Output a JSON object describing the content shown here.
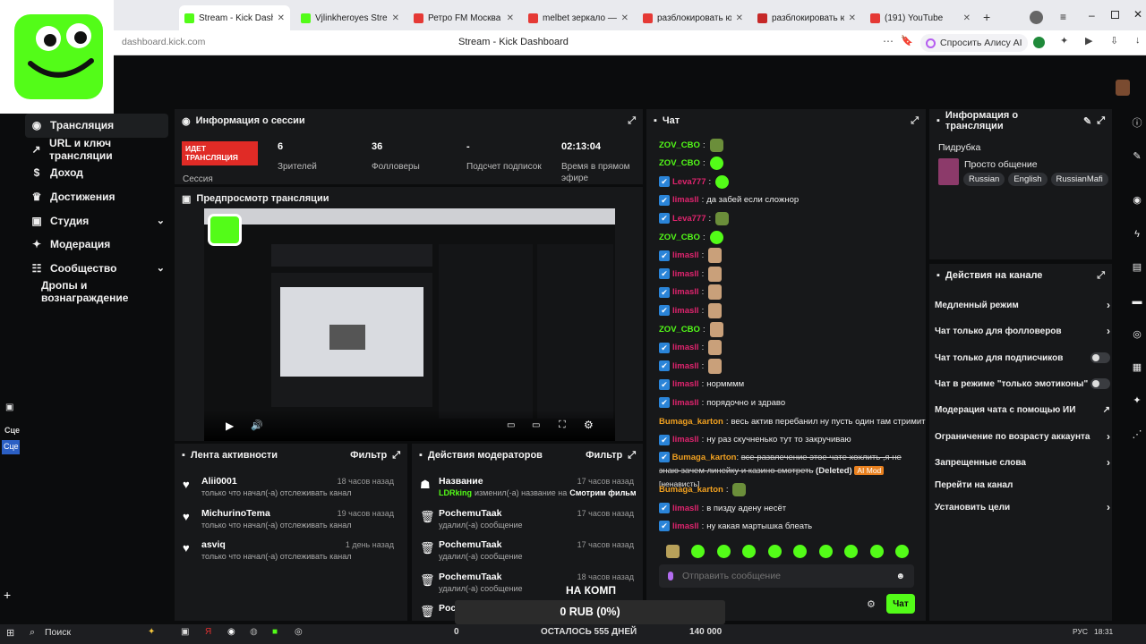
{
  "browser": {
    "tabs": [
      {
        "label": "Stream - Kick Dashbo",
        "active": true,
        "color": "#53fc18"
      },
      {
        "label": "Vjlinkheroyes Stream - W",
        "active": false,
        "color": "#53fc18"
      },
      {
        "label": "Ретро FM Москва",
        "active": false,
        "color": "#e53935"
      },
      {
        "label": "melbet зеркало — Яндe",
        "active": false,
        "color": "#e53935"
      },
      {
        "label": "разблокировать ютуб в",
        "active": false,
        "color": "#e53935"
      },
      {
        "label": "разблокировать ютуб",
        "active": false,
        "color": "#c62828"
      },
      {
        "label": "(191) YouTube",
        "active": false,
        "color": "#e53935"
      }
    ],
    "address": "dashboard.kick.com",
    "page_title": "Stream - Kick Dashboard",
    "alice_label": "Спросить Алису AI"
  },
  "sidebar": {
    "items": [
      {
        "label": "Трансляция",
        "icon": "broadcast-icon",
        "active": true,
        "chev": false
      },
      {
        "label": "URL и ключ трансляции",
        "icon": "link-icon",
        "active": false,
        "chev": false
      },
      {
        "label": "Доход",
        "icon": "dollar-icon",
        "active": false,
        "chev": false
      },
      {
        "label": "Достижения",
        "icon": "trophy-icon",
        "active": false,
        "chev": false
      },
      {
        "label": "Студия",
        "icon": "studio-icon",
        "active": false,
        "chev": true
      },
      {
        "label": "Модерация",
        "icon": "wrench-icon",
        "active": false,
        "chev": false
      },
      {
        "label": "Сообщество",
        "icon": "community-icon",
        "active": false,
        "chev": true
      },
      {
        "label": "Дропы и вознаграждение",
        "icon": "",
        "active": false,
        "chev": false
      }
    ],
    "scene_label": "Сце"
  },
  "session": {
    "title": "Информация о сессии",
    "live_badge": "ИДЕТ ТРАНСЛЯЦИЯ",
    "session_label": "Сессия",
    "stats": [
      {
        "value": "6",
        "label": "Зрителей"
      },
      {
        "value": "36",
        "label": "Фолловеры"
      },
      {
        "value": "-",
        "label": "Подсчет подписок"
      },
      {
        "value": "02:13:04",
        "label": "Время в прямом эфире"
      }
    ]
  },
  "preview": {
    "title": "Предпросмотр трансляции"
  },
  "activity": {
    "title": "Лента активности",
    "filter": "Фильтр",
    "items": [
      {
        "name": "Alii0001",
        "text": "только что начал(-а) отслеживать канал",
        "time": "18 часов назад"
      },
      {
        "name": "MichurinoTema",
        "text": "только что начал(-а) отслеживать канал",
        "time": "19 часов назад"
      },
      {
        "name": "asviq",
        "text": "только что начал(-а) отслеживать канал",
        "time": "1 день назад"
      }
    ]
  },
  "moderators": {
    "title": "Действия модераторов",
    "filter": "Фильтр",
    "items": [
      {
        "name": "Название",
        "user": "LDRking",
        "text": "изменил(-а) название на",
        "extra": "Смотрим фильм",
        "time": "17 часов назад",
        "icon": "person-icon"
      },
      {
        "name": "PochemuTaak",
        "user": "",
        "text": "удалил(-а) сообщение",
        "extra": "",
        "time": "17 часов назад",
        "icon": "trash-icon"
      },
      {
        "name": "PochemuTaak",
        "user": "",
        "text": "удалил(-а) сообщение",
        "extra": "",
        "time": "17 часов назад",
        "icon": "trash-icon"
      },
      {
        "name": "PochemuTaak",
        "user": "",
        "text": "удалил(-а) сообщение",
        "extra": "",
        "time": "18 часов назад",
        "icon": "trash-icon"
      },
      {
        "name": "Poch",
        "user": "",
        "text": "",
        "extra": "",
        "time": "",
        "icon": "trash-icon"
      }
    ],
    "overlay_text": "НА КОМП"
  },
  "chat": {
    "title": "Чат",
    "lines": [
      {
        "user": "ZOV_CBO",
        "color": "#53fc18",
        "badge": false,
        "text": "",
        "emote": "frog"
      },
      {
        "user": "ZOV_CBO",
        "color": "#53fc18",
        "badge": false,
        "text": "",
        "emote": "kick"
      },
      {
        "user": "Leva777",
        "color": "#e0246e",
        "badge": true,
        "text": "",
        "emote": "kick"
      },
      {
        "user": "limasll",
        "color": "#e0246e",
        "badge": true,
        "text": "да забей если сложнор",
        "emote": ""
      },
      {
        "user": "Leva777",
        "color": "#e0246e",
        "badge": true,
        "text": "",
        "emote": "frog"
      },
      {
        "user": "ZOV_CBO",
        "color": "#53fc18",
        "badge": false,
        "text": "",
        "emote": "kick"
      },
      {
        "user": "limasll",
        "color": "#e0246e",
        "badge": true,
        "text": "",
        "emote": "face"
      },
      {
        "user": "limasll",
        "color": "#e0246e",
        "badge": true,
        "text": "",
        "emote": "face"
      },
      {
        "user": "limasll",
        "color": "#e0246e",
        "badge": true,
        "text": "",
        "emote": "face"
      },
      {
        "user": "limasll",
        "color": "#e0246e",
        "badge": true,
        "text": "",
        "emote": "face"
      },
      {
        "user": "ZOV_CBO",
        "color": "#53fc18",
        "badge": false,
        "text": "",
        "emote": "face"
      },
      {
        "user": "limasll",
        "color": "#e0246e",
        "badge": true,
        "text": "",
        "emote": "face"
      },
      {
        "user": "limasll",
        "color": "#e0246e",
        "badge": true,
        "text": "",
        "emote": "face"
      },
      {
        "user": "limasll",
        "color": "#e0246e",
        "badge": true,
        "text": "нормммм",
        "emote": ""
      },
      {
        "user": "limasll",
        "color": "#e0246e",
        "badge": true,
        "text": "порядочно и здраво",
        "emote": ""
      },
      {
        "user": "Bumaga_karton",
        "color": "#f0a020",
        "badge": false,
        "text": "весь актив перебанил ну пусть один там стримит",
        "emote": ""
      },
      {
        "user": "limasll",
        "color": "#e0246e",
        "badge": true,
        "text": "ну раз скучненько тут то закручиваю",
        "emote": ""
      }
    ],
    "deleted_line": {
      "user": "Bumaga_karton",
      "text": "все развлечение этое чате хохлить ,я не знаю зачем линейку и казино смотреть",
      "deleted": "(Deleted)",
      "ai": "AI Mod",
      "reason": "[ненависть]"
    },
    "tail": [
      {
        "user": "Bumaga_karton",
        "color": "#f0a020",
        "badge": false,
        "text": "",
        "emote": "frog"
      },
      {
        "user": "limasll",
        "color": "#e0246e",
        "badge": true,
        "text": "в пизду адену несёт",
        "emote": ""
      },
      {
        "user": "limasll",
        "color": "#e0246e",
        "badge": true,
        "text": "ну какая мартышка блеать",
        "emote": ""
      }
    ],
    "placeholder": "Отправить сообщение",
    "send": "Чат"
  },
  "stream_info": {
    "title": "Информация о трансляции",
    "stream_name": "Пидрубка",
    "category": "Просто общение",
    "tags": [
      "Russian",
      "English",
      "RussianMafi"
    ]
  },
  "channel_actions": {
    "title": "Действия на канале",
    "rows": [
      {
        "label": "Медленный режим",
        "type": "chev"
      },
      {
        "label": "Чат только для фолловеров",
        "type": "chev"
      },
      {
        "label": "Чат только для подписчиков",
        "type": "toggle"
      },
      {
        "label": "Чат в режиме \"только эмотиконы\"",
        "type": "toggle"
      },
      {
        "label": "Модерация чата с помощью ИИ",
        "type": "ext"
      },
      {
        "label": "Ограничение по возрасту аккаунта",
        "type": "chev"
      },
      {
        "label": "Запрещенные слова",
        "type": "chev"
      },
      {
        "label": "Перейти на канал",
        "type": "none"
      },
      {
        "label": "Установить цели",
        "type": "chev"
      }
    ]
  },
  "overlay": {
    "rub": "0 RUB (0%)",
    "left": "0",
    "remaining": "ОСТАЛОСЬ 555 ДНЕЙ",
    "goal": "140 000"
  },
  "taskbar": {
    "search": "Поиск",
    "lang": "РУС",
    "time": "18:31"
  }
}
